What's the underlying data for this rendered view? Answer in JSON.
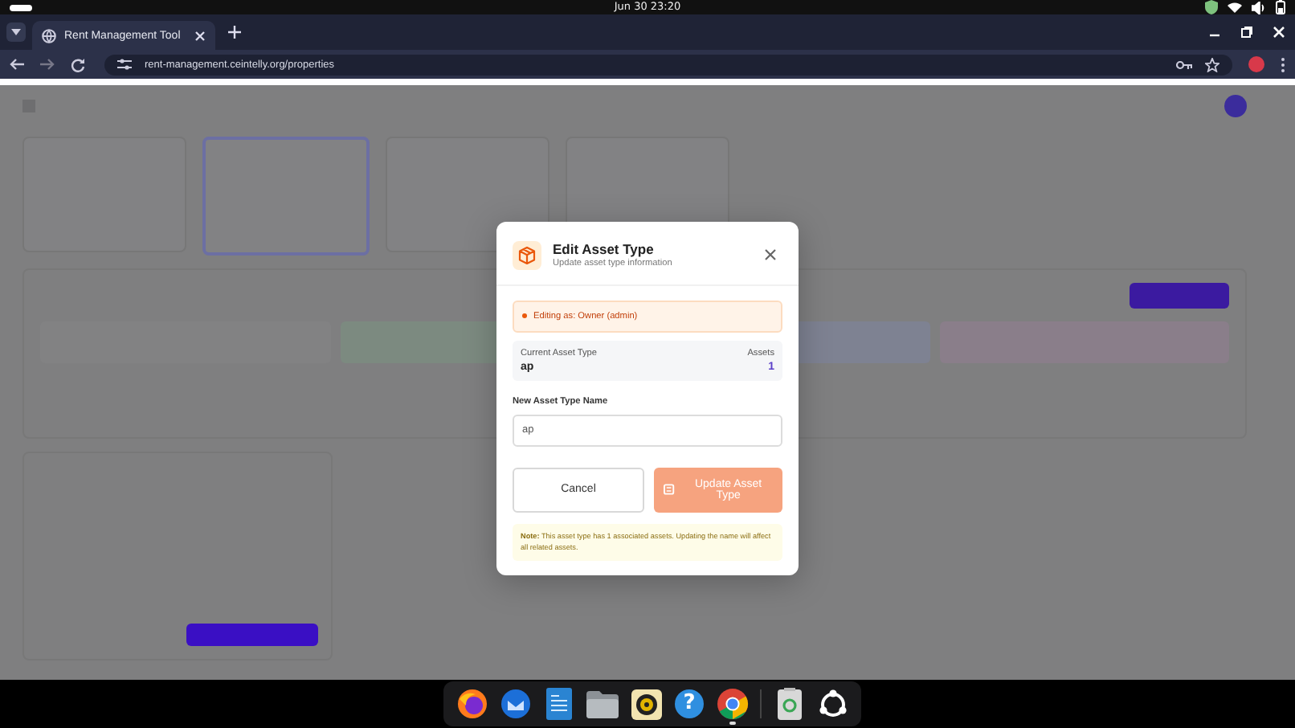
{
  "system_bar": {
    "clock": "Jun 30  23:20"
  },
  "browser": {
    "tab": {
      "title": "Rent Management Tool",
      "selected": true
    },
    "url": "rent-management.ceintelly.org/properties"
  },
  "dialog": {
    "title": "Edit Asset Type",
    "subtitle": "Update asset type information",
    "notice": "Editing as: Owner (admin)",
    "current": {
      "label": "Current Asset Type",
      "value": "ap",
      "count_label": "Assets",
      "count": "1"
    },
    "field": {
      "label": "New Asset Type Name",
      "value": "ap"
    },
    "buttons": [
      {
        "label": "Cancel",
        "kind": "secondary",
        "disabled": false
      },
      {
        "label": "Update Asset Type",
        "kind": "primary",
        "disabled": true
      }
    ],
    "note": "**Note:** This asset type has 1 associated assets. Updating the name will affect all related assets."
  },
  "dock": [
    {
      "kind": "firefox",
      "running": false
    },
    {
      "kind": "thunderbird",
      "running": false
    },
    {
      "kind": "writer",
      "running": false
    },
    {
      "kind": "files",
      "running": false
    },
    {
      "kind": "rhythmbox",
      "running": false
    },
    {
      "kind": "help",
      "glyph": "?",
      "running": false
    },
    {
      "kind": "chrome",
      "running": true
    },
    {
      "kind": "trash",
      "running": false
    },
    {
      "kind": "apps",
      "running": false
    }
  ]
}
